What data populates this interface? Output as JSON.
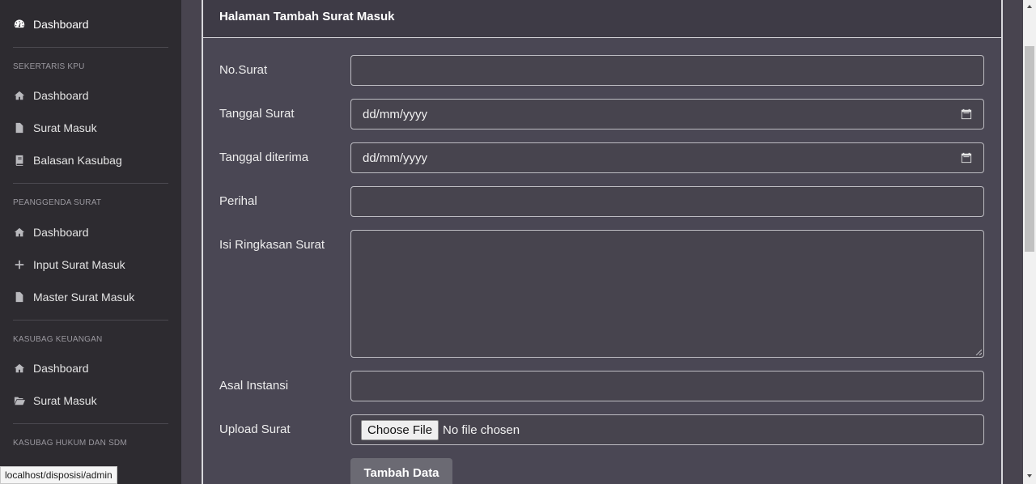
{
  "sidebar": {
    "top_item": {
      "label": "Dashboard",
      "icon": "tachometer-icon"
    },
    "sections": [
      {
        "heading": "SEKERTARIS KPU",
        "items": [
          {
            "label": "Dashboard",
            "icon": "home-icon"
          },
          {
            "label": "Surat Masuk",
            "icon": "file-icon"
          },
          {
            "label": "Balasan Kasubag",
            "icon": "book-icon"
          }
        ]
      },
      {
        "heading": "PEANGGENDA SURAT",
        "items": [
          {
            "label": "Dashboard",
            "icon": "home-icon"
          },
          {
            "label": "Input Surat Masuk",
            "icon": "plus-icon"
          },
          {
            "label": "Master Surat Masuk",
            "icon": "file-icon"
          }
        ]
      },
      {
        "heading": "KASUBAG KEUANGAN",
        "items": [
          {
            "label": "Dashboard",
            "icon": "home-icon"
          },
          {
            "label": "Surat Masuk",
            "icon": "folder-open-icon"
          }
        ]
      },
      {
        "heading": "KASUBAG HUKUM DAN SDM",
        "items": []
      }
    ]
  },
  "card": {
    "title": "Halaman Tambah Surat Masuk"
  },
  "form": {
    "no_surat": {
      "label": "No.Surat",
      "value": ""
    },
    "tanggal_surat": {
      "label": "Tanggal Surat",
      "value": "dd/mm/yyyy"
    },
    "tanggal_diterima": {
      "label": "Tanggal diterima",
      "value": "dd/mm/yyyy"
    },
    "perihal": {
      "label": "Perihal",
      "value": ""
    },
    "isi_ringkasan": {
      "label": "Isi Ringkasan Surat",
      "value": ""
    },
    "asal_instansi": {
      "label": "Asal Instansi",
      "value": ""
    },
    "upload_surat": {
      "label": "Upload Surat",
      "button_label": "Choose File",
      "status": "No file chosen"
    },
    "submit_label": "Tambah Data"
  },
  "status_bar": {
    "url": "localhost/disposisi/admin"
  },
  "colors": {
    "sidebar_bg": "#2d2b30",
    "main_bg": "#48444f",
    "card_header_bg": "#3e3b46",
    "submit_bg": "#6b6a73"
  }
}
